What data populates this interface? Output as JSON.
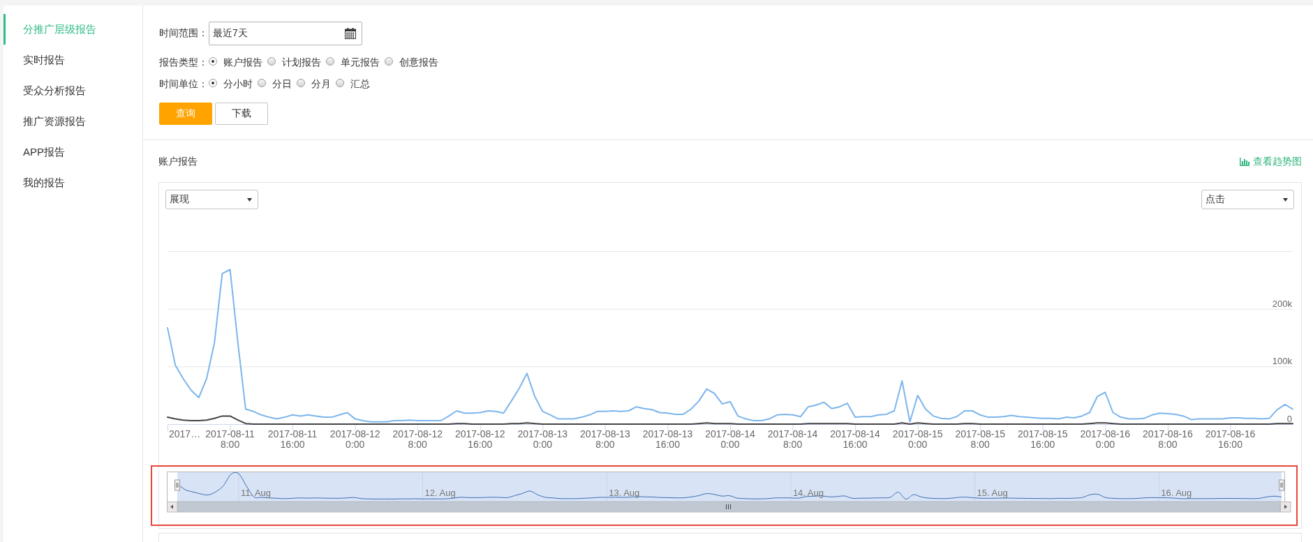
{
  "sidebar": {
    "items": [
      {
        "label": "分推广层级报告",
        "selected": true
      },
      {
        "label": "实时报告",
        "selected": false
      },
      {
        "label": "受众分析报告",
        "selected": false
      },
      {
        "label": "推广资源报告",
        "selected": false
      },
      {
        "label": "APP报告",
        "selected": false
      },
      {
        "label": "我的报告",
        "selected": false
      }
    ]
  },
  "filters": {
    "time_range": {
      "label": "时间范围：",
      "value": "最近7天"
    },
    "report_type": {
      "label": "报告类型：",
      "options": [
        {
          "label": "账户报告",
          "selected": true
        },
        {
          "label": "计划报告",
          "selected": false
        },
        {
          "label": "单元报告",
          "selected": false
        },
        {
          "label": "创意报告",
          "selected": false
        }
      ]
    },
    "time_unit": {
      "label": "时间单位：",
      "options": [
        {
          "label": "分小时",
          "selected": true
        },
        {
          "label": "分日",
          "selected": false
        },
        {
          "label": "分月",
          "selected": false
        },
        {
          "label": "汇总",
          "selected": false
        }
      ]
    }
  },
  "buttons": [
    {
      "label": "查询",
      "kind": "primary"
    },
    {
      "label": "下载",
      "kind": "default"
    }
  ],
  "report": {
    "title": "账户报告",
    "trend_link": "查看趋势图",
    "left_metric": "展现",
    "right_metric": "点击",
    "axis_start_label": "2017…",
    "chart_data": {
      "type": "line",
      "categories": [
        null,
        null,
        null,
        null,
        null,
        null,
        null,
        null,
        "2017-08-11\n8:00",
        null,
        null,
        null,
        null,
        null,
        null,
        null,
        "2017-08-11\n16:00",
        null,
        null,
        null,
        null,
        null,
        null,
        null,
        "2017-08-12\n0:00",
        null,
        null,
        null,
        null,
        null,
        null,
        null,
        "2017-08-12\n8:00",
        null,
        null,
        null,
        null,
        null,
        null,
        null,
        "2017-08-12\n16:00",
        null,
        null,
        null,
        null,
        null,
        null,
        null,
        "2017-08-13\n0:00",
        null,
        null,
        null,
        null,
        null,
        null,
        null,
        "2017-08-13\n8:00",
        null,
        null,
        null,
        null,
        null,
        null,
        null,
        "2017-08-13\n16:00",
        null,
        null,
        null,
        null,
        null,
        null,
        null,
        "2017-08-14\n0:00",
        null,
        null,
        null,
        null,
        null,
        null,
        null,
        "2017-08-14\n8:00",
        null,
        null,
        null,
        null,
        null,
        null,
        null,
        "2017-08-14\n16:00",
        null,
        null,
        null,
        null,
        null,
        null,
        null,
        "2017-08-15\n0:00",
        null,
        null,
        null,
        null,
        null,
        null,
        null,
        "2017-08-15\n8:00",
        null,
        null,
        null,
        null,
        null,
        null,
        null,
        "2017-08-15\n16:00",
        null,
        null,
        null,
        null,
        null,
        null,
        null,
        "2017-08-16\n0:00",
        null,
        null,
        null,
        null,
        null,
        null,
        null,
        "2017-08-16\n8:00",
        null,
        null,
        null,
        null,
        null,
        null,
        null,
        "2017-08-16\n16:00",
        null,
        null,
        null,
        null,
        null,
        null,
        null,
        null
      ],
      "ylim": [
        0,
        300000
      ],
      "yticks": [
        0,
        {
          "value": 100000,
          "label": "100k"
        },
        {
          "value": 200000,
          "label": "200k"
        }
      ],
      "series": [
        {
          "color": "#7cb5ec",
          "values": [
            167000,
            102000,
            79000,
            59000,
            46000,
            79000,
            141000,
            261000,
            268000,
            141000,
            26000,
            22000,
            16000,
            12000,
            9000,
            12000,
            16000,
            14000,
            16000,
            14000,
            12000,
            12000,
            16000,
            20000,
            9000,
            6000,
            4000,
            4000,
            4000,
            6000,
            6000,
            7000,
            6000,
            6000,
            6000,
            6000,
            14000,
            23000,
            19000,
            19000,
            20000,
            23000,
            22000,
            19000,
            40000,
            62000,
            88000,
            48000,
            22000,
            16000,
            9000,
            9000,
            9000,
            12000,
            16000,
            22000,
            22000,
            23000,
            22000,
            23000,
            30000,
            27000,
            25000,
            20000,
            19000,
            17000,
            17000,
            26000,
            40000,
            61000,
            53000,
            35000,
            39000,
            14000,
            9000,
            6000,
            6000,
            9000,
            16000,
            17000,
            16000,
            13000,
            30000,
            33000,
            38000,
            27000,
            30000,
            36000,
            12000,
            13000,
            13000,
            16000,
            17000,
            23000,
            75000,
            4000,
            50000,
            26000,
            14000,
            10000,
            9000,
            13000,
            23000,
            23000,
            16000,
            12000,
            12000,
            13000,
            15000,
            13000,
            12000,
            11000,
            10000,
            10000,
            9000,
            12000,
            11000,
            14000,
            20000,
            48000,
            55000,
            20000,
            12000,
            9000,
            9000,
            10000,
            16000,
            19000,
            18000,
            17000,
            14000,
            8000,
            9000,
            9000,
            9000,
            9000,
            11000,
            11000,
            10000,
            10000,
            9000,
            10000,
            25000,
            34000,
            26000
          ]
        },
        {
          "color": "#434348",
          "values": [
            12000,
            9000,
            7000,
            6000,
            6000,
            7000,
            10000,
            14000,
            14000,
            7000,
            1000,
            0,
            0,
            0,
            0,
            0,
            0,
            0,
            0,
            0,
            0,
            0,
            0,
            0,
            0,
            0,
            0,
            0,
            0,
            0,
            0,
            0,
            0,
            0,
            0,
            0,
            0,
            1000,
            1000,
            0,
            0,
            0,
            0,
            0,
            1000,
            1000,
            2000,
            1000,
            0,
            0,
            0,
            0,
            0,
            0,
            0,
            0,
            0,
            0,
            0,
            0,
            0,
            0,
            0,
            0,
            0,
            0,
            0,
            0,
            1000,
            2000,
            1000,
            1000,
            1000,
            0,
            0,
            0,
            0,
            0,
            0,
            0,
            0,
            0,
            1000,
            1000,
            1000,
            1000,
            1000,
            1000,
            0,
            0,
            0,
            0,
            0,
            0,
            2000,
            0,
            2000,
            1000,
            0,
            0,
            0,
            0,
            1000,
            1000,
            0,
            0,
            0,
            0,
            0,
            0,
            0,
            0,
            0,
            0,
            0,
            0,
            0,
            0,
            1000,
            2000,
            2000,
            1000,
            0,
            0,
            0,
            0,
            0,
            0,
            0,
            0,
            0,
            0,
            0,
            0,
            0,
            0,
            0,
            0,
            0,
            0,
            0,
            0,
            1000,
            1000,
            1000
          ]
        }
      ]
    },
    "navigator": {
      "highlighted": true,
      "labels": [
        "11. Aug",
        "12. Aug",
        "13. Aug",
        "14. Aug",
        "15. Aug",
        "16. Aug"
      ]
    }
  }
}
